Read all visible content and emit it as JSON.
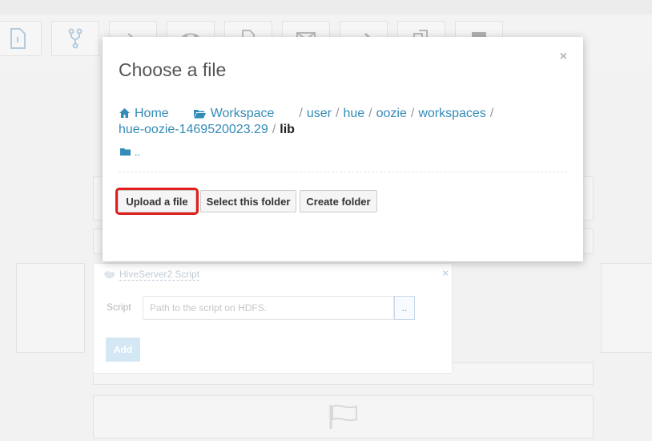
{
  "background": {
    "toolbar_icons": [
      "hive-file-icon",
      "fork-icon",
      "shell-icon",
      "phone-icon",
      "document-icon",
      "mail-icon",
      "arrow-icon",
      "multi-document-icon",
      "stop-icon"
    ]
  },
  "node": {
    "title": "HiveServer2 Script",
    "script_label": "Script",
    "script_placeholder": "Path to the script on HDFS.",
    "browse_label": "..",
    "add_label": "Add"
  },
  "modal": {
    "title": "Choose a file",
    "close_glyph": "×",
    "breadcrumb": {
      "home": "Home",
      "workspace": "Workspace",
      "path": [
        "user",
        "hue",
        "oozie",
        "workspaces",
        "hue-oozie-1469520023.29"
      ],
      "current": "lib",
      "separator": "/"
    },
    "parent_label": "..",
    "buttons": {
      "upload": "Upload a file",
      "select": "Select this folder",
      "create": "Create folder"
    }
  },
  "colors": {
    "link": "#338bb8",
    "highlight": "#e01e1e"
  }
}
